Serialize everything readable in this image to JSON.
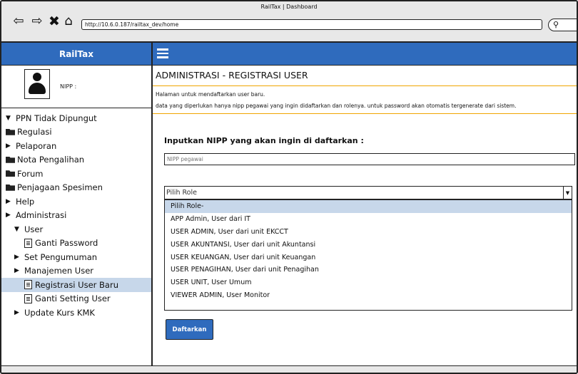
{
  "window": {
    "title": "RailTax | Dashboard",
    "url": "http://10.6.0.187/railtax_dev/home"
  },
  "sidebar": {
    "brand": "RailTax",
    "profile_label": "NIPP :",
    "items": [
      {
        "label": "PPN Tidak Dipungut",
        "icon": "caret-down",
        "level": 0
      },
      {
        "label": "Regulasi",
        "icon": "folder-open",
        "level": 0
      },
      {
        "label": "Pelaporan",
        "icon": "caret-right",
        "level": 0
      },
      {
        "label": "Nota Pengalihan",
        "icon": "folder-open",
        "level": 0
      },
      {
        "label": "Forum",
        "icon": "folder-open",
        "level": 0
      },
      {
        "label": "Penjagaan Spesimen",
        "icon": "folder-open",
        "level": 0
      },
      {
        "label": "Help",
        "icon": "caret-right",
        "level": 0
      },
      {
        "label": "Administrasi",
        "icon": "caret-right",
        "level": 0
      },
      {
        "label": "User",
        "icon": "caret-down",
        "level": 1
      },
      {
        "label": "Ganti Password",
        "icon": "document",
        "level": 2
      },
      {
        "label": "Set Pengumuman",
        "icon": "caret-right",
        "level": 1
      },
      {
        "label": "Manajemen User",
        "icon": "caret-right",
        "level": 1
      },
      {
        "label": "Registrasi User Baru",
        "icon": "document",
        "level": 2,
        "selected": true
      },
      {
        "label": "Ganti Setting User",
        "icon": "document",
        "level": 2
      },
      {
        "label": "Update Kurs KMK",
        "icon": "caret-right",
        "level": 1
      }
    ]
  },
  "main": {
    "title": "ADMINISTRASI - REGISTRASI USER",
    "description_1": "Halaman untuk mendaftarkan user baru.",
    "description_2": "data yang diperlukan hanya nipp pegawai yang ingin didaftarkan dan rolenya. untuk password akan otomatis tergenerate dari sistem.",
    "form_label": "Inputkan NIPP yang akan ingin di daftarkan :",
    "nipp_placeholder": "NIPP pegawai",
    "role_selected": "Pilih Role",
    "role_options": [
      "Pilih Role-",
      "APP Admin, User dari IT",
      "USER ADMIN, User dari unit EKCCT",
      "USER AKUNTANSI, User dari unit Akuntansi",
      "USER KEUANGAN, User dari unit Keuangan",
      "USER PENAGIHAN, User dari unit Penagihan",
      "USER UNIT, User Umum",
      "VIEWER ADMIN, User Monitor"
    ],
    "submit_label": "Daftarkan"
  },
  "colors": {
    "brand_blue": "#2f6bbd",
    "selection": "#c7d7ea",
    "divider_orange": "#f0a500"
  }
}
